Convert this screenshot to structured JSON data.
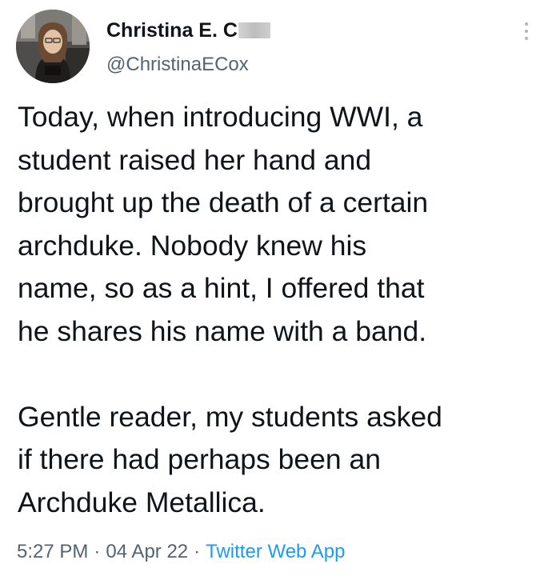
{
  "author": {
    "display_name": "Christina E. C",
    "handle": "@ChristinaECox"
  },
  "tweet": {
    "text": "Today, when introducing WWI, a\nstudent raised her hand and\nbrought up the death of a certain\narchduke. Nobody knew his\nname, so as a hint, I offered that\nhe shares his name with a band.\n\nGentle reader, my students asked\nif there had perhaps been an\nArchduke Metallica.",
    "time": "5:27 PM",
    "separator": "·",
    "date": "04 Apr 22",
    "source": "Twitter Web App"
  },
  "icons": {
    "more": "more-vertical-icon",
    "avatar": "profile-photo"
  },
  "colors": {
    "text": "#0f1419",
    "secondary": "#536471",
    "link": "#1d9bf0",
    "background": "#ffffff"
  }
}
